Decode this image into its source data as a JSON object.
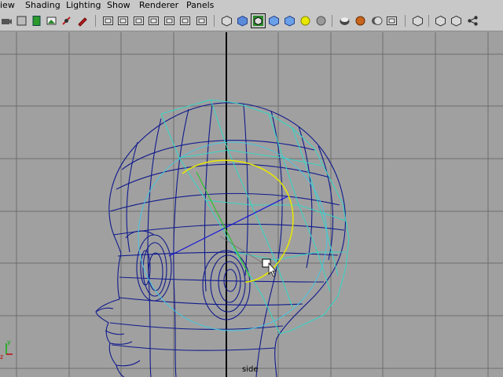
{
  "menubar": {
    "items": [
      "iew",
      "Shading",
      "Lighting",
      "Show",
      "Renderer",
      "Panels"
    ]
  },
  "toolbar": {
    "icons": [
      "camera-select-icon",
      "camera-attributes-icon",
      "bookmark-icon",
      "image-plane-icon",
      "two-d-pan-icon",
      "grease-pencil-icon",
      "grid-icon",
      "film-gate-icon",
      "resolution-gate-icon",
      "gate-mask-icon",
      "field-chart-icon",
      "safe-action-icon",
      "safe-title-icon",
      "wireframe-icon",
      "smooth-shade-icon",
      "wireframe-on-shaded-icon",
      "xray-icon",
      "textured-icon",
      "use-all-lights-icon",
      "shadows-icon",
      "high-quality-icon",
      "motion-blur-icon",
      "ambient-occlusion-icon",
      "depth-of-field-icon",
      "isolate-select-icon",
      "single-view-icon",
      "two-views-icon",
      "hypergraph-icon"
    ]
  },
  "viewport": {
    "camera_label": "side",
    "axis_labels": {
      "y": "y",
      "z": "z"
    },
    "colors": {
      "grid": "#6d6d6d",
      "axis": "#000000",
      "mesh": "#101a8c",
      "selected_curve": "#e8e800",
      "cage": "#3ad4c4",
      "guide": "#1414d8"
    }
  }
}
